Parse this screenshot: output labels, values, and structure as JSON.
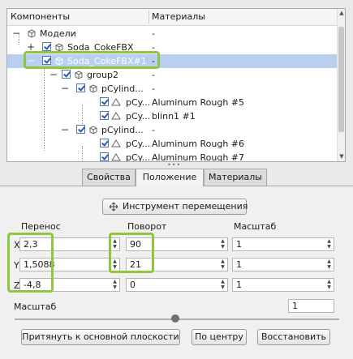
{
  "tree": {
    "col_components": "Компоненты",
    "col_materials": "Материалы",
    "rows": [
      {
        "name": "Модели",
        "material": "-"
      },
      {
        "name": "Soda_CokeFBX",
        "material": "-"
      },
      {
        "name": "Soda_CokeFBX#1",
        "material": "-"
      },
      {
        "name": "group2",
        "material": "-"
      },
      {
        "name": "pCylind...",
        "material": "-"
      },
      {
        "name": "pCy...",
        "material": "Aluminum Rough #5"
      },
      {
        "name": "pCy...",
        "material": "blinn1 #1"
      },
      {
        "name": "pCylind...",
        "material": "-"
      },
      {
        "name": "pCy...",
        "material": "Aluminum Rough #6"
      },
      {
        "name": "pCy...",
        "material": "Aluminum Rough #7"
      }
    ]
  },
  "tabs": [
    "Свойства",
    "Положение",
    "Материалы"
  ],
  "active_tab": "Положение",
  "tool_button": "Инструмент перемещения",
  "headers": {
    "translate": "Перенос",
    "rotate": "Поворот",
    "scale": "Масштаб"
  },
  "axes": [
    "X",
    "Y",
    "Z"
  ],
  "translate": [
    "2,3",
    "1,5088",
    "-4,8"
  ],
  "rotate": [
    "90",
    "21",
    "0"
  ],
  "scale": [
    "1",
    "1",
    "1"
  ],
  "scale_label": "Масштаб",
  "scale_value": "1",
  "buttons": {
    "snap": "Притянуть к основной плоскости",
    "center": "По центру",
    "restore": "Восстановить"
  },
  "colors": {
    "highlight": "#8dc63f",
    "selection": "#b9cff0"
  }
}
